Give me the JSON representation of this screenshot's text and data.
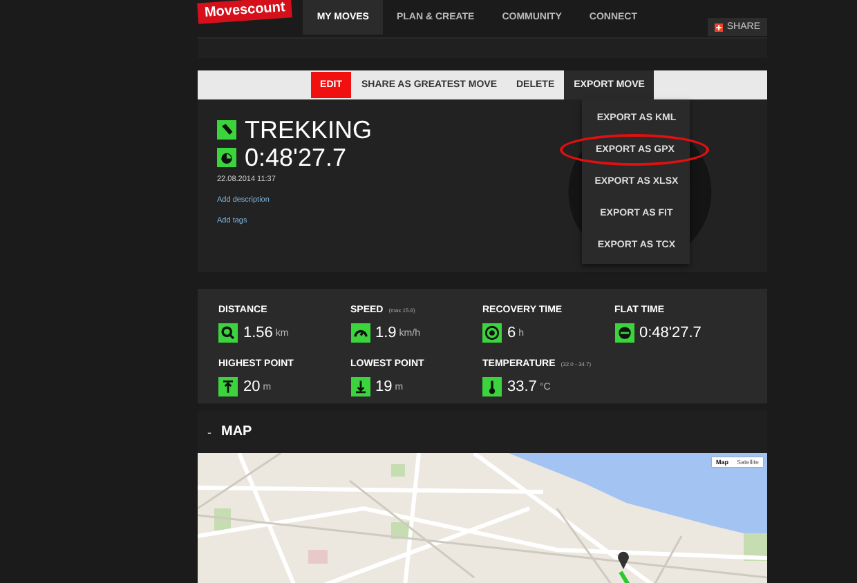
{
  "logo": "Movescount",
  "nav": [
    {
      "label": "MY MOVES",
      "selected": true
    },
    {
      "label": "PLAN & CREATE",
      "selected": false
    },
    {
      "label": "COMMUNITY",
      "selected": false
    },
    {
      "label": "CONNECT",
      "selected": false
    }
  ],
  "share": "SHARE",
  "toolbar": [
    {
      "label": "EDIT",
      "selected": true,
      "expanded": false
    },
    {
      "label": "SHARE AS GREATEST MOVE",
      "selected": false,
      "expanded": false
    },
    {
      "label": "DELETE",
      "selected": false,
      "expanded": false
    },
    {
      "label": "EXPORT MOVE",
      "selected": false,
      "expanded": true
    }
  ],
  "export_menu": [
    {
      "label": "EXPORT AS KML",
      "circled": false
    },
    {
      "label": "EXPORT AS GPX",
      "circled": true
    },
    {
      "label": "EXPORT AS XLSX",
      "circled": false
    },
    {
      "label": "EXPORT AS FIT",
      "circled": false
    },
    {
      "label": "EXPORT AS TCX",
      "circled": false
    }
  ],
  "move": {
    "activity": "TREKKING",
    "duration": "0:48'27.7",
    "date": "22.08.2014 11:37",
    "links": [
      "Add description",
      "Add tags"
    ]
  },
  "stats": [
    {
      "kind": "distance",
      "label": "DISTANCE",
      "value": "1.56",
      "unit": "km"
    },
    {
      "kind": "speed",
      "label": "SPEED",
      "note": "(max 15.6)",
      "value": "1.9",
      "unit": "km/h"
    },
    {
      "kind": "recovery",
      "label": "RECOVERY TIME",
      "value": "6",
      "unit": "h"
    },
    {
      "kind": "flat",
      "label": "FLAT TIME",
      "value": "0:48'27.7"
    },
    {
      "kind": "up",
      "label": "HIGHEST POINT",
      "value": "20",
      "unit": "m"
    },
    {
      "kind": "down",
      "label": "LOWEST POINT",
      "value": "19",
      "unit": "m"
    },
    {
      "kind": "temp",
      "label": "TEMPERATURE",
      "note": "(32.0 - 34.7)",
      "value": "33.7",
      "unit": "°C"
    }
  ],
  "map": {
    "toggle": "-",
    "title": "MAP",
    "types": [
      {
        "label": "Map",
        "selected": true
      },
      {
        "label": "Satellite",
        "selected": false
      }
    ]
  }
}
